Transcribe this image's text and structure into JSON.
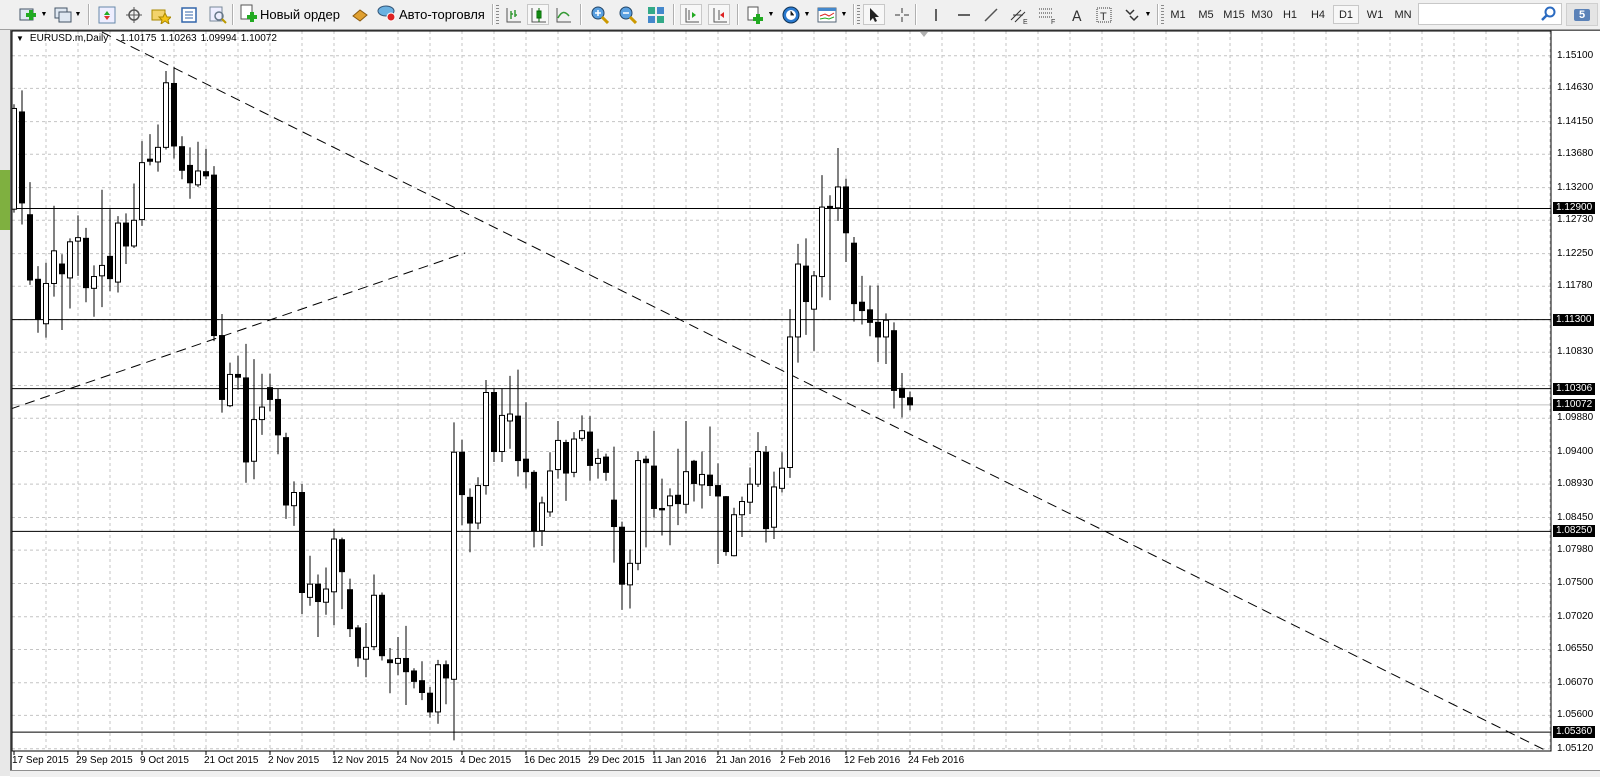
{
  "toolbar": {
    "new_order_label": "Новый ордер",
    "auto_trading_label": "Авто-торговля",
    "timeframes": [
      "M1",
      "M5",
      "M15",
      "M30",
      "H1",
      "H4",
      "D1",
      "W1",
      "MN"
    ],
    "active_timeframe": "D1",
    "search_placeholder": "",
    "chat_count": "5"
  },
  "chart_header": {
    "symbol": "EURUSD.m,Daily",
    "open": "1.10175",
    "high": "1.10263",
    "low": "1.09994",
    "close": "1.10072"
  },
  "price_axis": {
    "labels": [
      "1.15100",
      "1.14630",
      "1.14150",
      "1.13680",
      "1.13200",
      "1.12730",
      "1.12250",
      "1.11780",
      "1.10830",
      "1.09880",
      "1.09400",
      "1.08930",
      "1.08450",
      "1.07980",
      "1.07500",
      "1.07020",
      "1.06550",
      "1.06070",
      "1.05600",
      "1.05120"
    ],
    "grid_levels": [
      1.151,
      1.1463,
      1.1415,
      1.1368,
      1.132,
      1.1273,
      1.1225,
      1.1178,
      1.113,
      1.1083,
      1.1035,
      1.0988,
      1.094,
      1.0893,
      1.0845,
      1.0798,
      1.075,
      1.0702,
      1.0655,
      1.0607,
      1.056,
      1.0512
    ]
  },
  "horizontal_lines": [
    {
      "label": "1.12900",
      "price": 1.129,
      "color": "#000000"
    },
    {
      "label": "1.11300",
      "price": 1.113,
      "color": "#000000"
    },
    {
      "label": "1.10306",
      "price": 1.10306,
      "color": "#000000"
    },
    {
      "label": "1.10072",
      "price": 1.10072,
      "color": "#c0c0c0"
    },
    {
      "label": "1.08250",
      "price": 1.0825,
      "color": "#000000"
    },
    {
      "label": "1.05360",
      "price": 1.0536,
      "color": "#000000"
    }
  ],
  "date_axis": {
    "labels": [
      "17 Sep 2015",
      "29 Sep 2015",
      "9 Oct 2015",
      "21 Oct 2015",
      "2 Nov 2015",
      "12 Nov 2015",
      "24 Nov 2015",
      "4 Dec 2015",
      "16 Dec 2015",
      "29 Dec 2015",
      "11 Jan 2016",
      "21 Jan 2016",
      "2 Feb 2016",
      "12 Feb 2016",
      "24 Feb 2016"
    ],
    "bars_per_label": 8
  },
  "chart_data": {
    "type": "candlestick",
    "title": "EURUSD.m,Daily",
    "ylim": [
      1.0512,
      1.1544
    ],
    "grid": true,
    "ohlc_format": [
      "open",
      "high",
      "low",
      "close"
    ],
    "ohlc": [
      [
        1.1289,
        1.144,
        1.1284,
        1.1434
      ],
      [
        1.1429,
        1.146,
        1.1267,
        1.1298
      ],
      [
        1.1281,
        1.1328,
        1.118,
        1.1187
      ],
      [
        1.1188,
        1.1207,
        1.1111,
        1.1131
      ],
      [
        1.1124,
        1.1212,
        1.1104,
        1.1182
      ],
      [
        1.1182,
        1.1294,
        1.1163,
        1.1229
      ],
      [
        1.121,
        1.1224,
        1.1115,
        1.1196
      ],
      [
        1.119,
        1.1247,
        1.1146,
        1.1242
      ],
      [
        1.1243,
        1.128,
        1.1193,
        1.1248
      ],
      [
        1.1247,
        1.1262,
        1.1155,
        1.1176
      ],
      [
        1.1175,
        1.1208,
        1.1134,
        1.1192
      ],
      [
        1.1193,
        1.1317,
        1.1148,
        1.1208
      ],
      [
        1.1221,
        1.1289,
        1.1171,
        1.1189
      ],
      [
        1.1184,
        1.1279,
        1.1169,
        1.1269
      ],
      [
        1.1269,
        1.1283,
        1.121,
        1.1236
      ],
      [
        1.1236,
        1.1326,
        1.1233,
        1.1273
      ],
      [
        1.1274,
        1.1387,
        1.1265,
        1.1356
      ],
      [
        1.1361,
        1.1397,
        1.1352,
        1.1358
      ],
      [
        1.1357,
        1.1411,
        1.1343,
        1.1378
      ],
      [
        1.1378,
        1.1488,
        1.1375,
        1.1471
      ],
      [
        1.147,
        1.1494,
        1.1362,
        1.138
      ],
      [
        1.1379,
        1.1394,
        1.1332,
        1.1345
      ],
      [
        1.1352,
        1.1378,
        1.1304,
        1.1327
      ],
      [
        1.1324,
        1.1386,
        1.1321,
        1.1344
      ],
      [
        1.1343,
        1.1376,
        1.1332,
        1.1337
      ],
      [
        1.1338,
        1.1351,
        1.1099,
        1.1107
      ],
      [
        1.1107,
        1.1138,
        1.0996,
        1.1015
      ],
      [
        1.1006,
        1.1068,
        1.1004,
        1.1051
      ],
      [
        1.1051,
        1.1078,
        1.1029,
        1.1047
      ],
      [
        1.1046,
        1.1095,
        1.0895,
        1.0925
      ],
      [
        1.0926,
        1.1073,
        1.09,
        1.0986
      ],
      [
        1.0986,
        1.1052,
        1.0964,
        1.1004
      ],
      [
        1.1032,
        1.1052,
        1.0998,
        1.1015
      ],
      [
        1.1015,
        1.103,
        1.0936,
        1.0964
      ],
      [
        1.096,
        1.0967,
        1.0843,
        1.0863
      ],
      [
        1.0862,
        1.0897,
        1.0833,
        1.0881
      ],
      [
        1.0881,
        1.0893,
        1.0706,
        1.0737
      ],
      [
        1.073,
        1.079,
        1.0718,
        1.0749
      ],
      [
        1.0749,
        1.0763,
        1.0673,
        1.0724
      ],
      [
        1.0723,
        1.0773,
        1.0705,
        1.0742
      ],
      [
        1.0738,
        1.0829,
        1.069,
        1.0814
      ],
      [
        1.0813,
        1.0816,
        1.0713,
        1.0767
      ],
      [
        1.0741,
        1.0757,
        1.0673,
        1.0685
      ],
      [
        1.0686,
        1.069,
        1.063,
        1.0643
      ],
      [
        1.0641,
        1.0693,
        1.0615,
        1.0658
      ],
      [
        1.0659,
        1.0763,
        1.0654,
        1.0733
      ],
      [
        1.0733,
        1.0737,
        1.0639,
        1.0646
      ],
      [
        1.064,
        1.0657,
        1.0592,
        1.0636
      ],
      [
        1.0635,
        1.0673,
        1.0618,
        1.0642
      ],
      [
        1.0642,
        1.0689,
        1.0575,
        1.0623
      ],
      [
        1.0624,
        1.0628,
        1.0599,
        1.0609
      ],
      [
        1.061,
        1.0638,
        1.0582,
        1.0593
      ],
      [
        1.0592,
        1.0601,
        1.0557,
        1.0565
      ],
      [
        1.0565,
        1.064,
        1.0548,
        1.0633
      ],
      [
        1.0633,
        1.0639,
        1.0576,
        1.0614
      ],
      [
        1.0612,
        1.0982,
        1.0524,
        1.0939
      ],
      [
        1.0939,
        1.0957,
        1.0834,
        1.0878
      ],
      [
        1.0874,
        1.0887,
        1.0795,
        1.0837
      ],
      [
        1.0837,
        1.0903,
        1.0828,
        1.0891
      ],
      [
        1.0891,
        1.1043,
        1.0878,
        1.1025
      ],
      [
        1.1025,
        1.1031,
        1.0925,
        1.094
      ],
      [
        1.094,
        1.1031,
        1.0925,
        1.0992
      ],
      [
        1.0984,
        1.1049,
        1.0944,
        1.0994
      ],
      [
        1.0991,
        1.1058,
        1.0904,
        1.0927
      ],
      [
        1.0929,
        1.1011,
        1.0887,
        1.0911
      ],
      [
        1.091,
        1.0913,
        1.0802,
        1.0826
      ],
      [
        1.0826,
        1.0875,
        1.0804,
        1.0866
      ],
      [
        1.0853,
        1.0939,
        1.0846,
        1.0912
      ],
      [
        1.0914,
        1.0984,
        1.0901,
        1.0956
      ],
      [
        1.0953,
        1.0957,
        1.0869,
        1.0909
      ],
      [
        1.091,
        1.0968,
        1.0903,
        1.0958
      ],
      [
        1.0959,
        1.0992,
        1.0955,
        1.097
      ],
      [
        1.0968,
        1.0991,
        1.0898,
        1.092
      ],
      [
        1.0923,
        1.0944,
        1.0901,
        1.093
      ],
      [
        1.0932,
        1.0937,
        1.0898,
        1.091
      ],
      [
        1.087,
        1.0947,
        1.078,
        1.0832
      ],
      [
        1.0831,
        1.0839,
        1.0712,
        1.0749
      ],
      [
        1.0748,
        1.0799,
        1.0714,
        1.0779
      ],
      [
        1.0779,
        1.094,
        1.0769,
        1.0927
      ],
      [
        1.0929,
        1.0934,
        1.0802,
        1.0924
      ],
      [
        1.0919,
        1.097,
        1.0845,
        1.0858
      ],
      [
        1.0858,
        1.0901,
        1.0819,
        1.0856
      ],
      [
        1.0862,
        1.0887,
        1.0805,
        1.0876
      ],
      [
        1.0877,
        1.0944,
        1.0834,
        1.0865
      ],
      [
        1.0864,
        1.0984,
        1.0851,
        1.0911
      ],
      [
        1.0926,
        1.0928,
        1.0868,
        1.0894
      ],
      [
        1.0892,
        1.094,
        1.0858,
        1.0907
      ],
      [
        1.0906,
        1.0976,
        1.0876,
        1.0891
      ],
      [
        1.0891,
        1.0923,
        1.0778,
        1.0876
      ],
      [
        1.0875,
        1.0876,
        1.079,
        1.0796
      ],
      [
        1.079,
        1.0859,
        1.0789,
        1.0849
      ],
      [
        1.0849,
        1.0875,
        1.0817,
        1.0868
      ],
      [
        1.0867,
        1.0917,
        1.085,
        1.0893
      ],
      [
        1.0893,
        1.0968,
        1.0889,
        1.094
      ],
      [
        1.0939,
        1.0948,
        1.0809,
        1.0829
      ],
      [
        1.0831,
        1.0911,
        1.0814,
        1.0889
      ],
      [
        1.0887,
        1.0939,
        1.0881,
        1.0916
      ],
      [
        1.0917,
        1.1145,
        1.0902,
        1.1105
      ],
      [
        1.1105,
        1.1239,
        1.1068,
        1.121
      ],
      [
        1.1207,
        1.1247,
        1.1108,
        1.1156
      ],
      [
        1.1145,
        1.12,
        1.1085,
        1.1193
      ],
      [
        1.1192,
        1.1338,
        1.1162,
        1.1292
      ],
      [
        1.1293,
        1.1309,
        1.1158,
        1.1291
      ],
      [
        1.1291,
        1.1377,
        1.1272,
        1.1321
      ],
      [
        1.1321,
        1.1333,
        1.1213,
        1.1255
      ],
      [
        1.124,
        1.1249,
        1.1127,
        1.1153
      ],
      [
        1.1155,
        1.1193,
        1.1123,
        1.1143
      ],
      [
        1.1144,
        1.1179,
        1.1106,
        1.1126
      ],
      [
        1.1126,
        1.1179,
        1.1069,
        1.1105
      ],
      [
        1.1105,
        1.1139,
        1.1066,
        1.1129
      ],
      [
        1.1114,
        1.1126,
        1.1002,
        1.1028
      ],
      [
        1.1031,
        1.1053,
        1.0989,
        1.1018
      ],
      [
        1.10175,
        1.10263,
        1.09994,
        1.10072
      ]
    ],
    "trendlines": [
      {
        "name": "descending-trendline",
        "from": {
          "bar": 11,
          "price": 1.1544
        },
        "to": {
          "bar": 191.9,
          "price": 1.0507
        }
      },
      {
        "name": "ascending-trendline",
        "from": {
          "bar": -0.5,
          "price": 1.1001
        },
        "to": {
          "bar": 56.4,
          "price": 1.1226
        }
      }
    ]
  }
}
